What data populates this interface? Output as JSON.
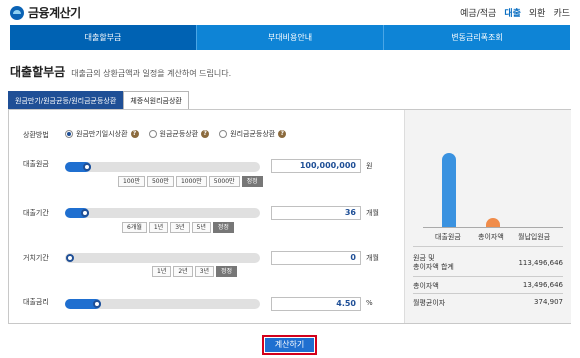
{
  "header": {
    "logo": "금융계산기",
    "nav": [
      "예금/적금",
      "대출",
      "외환",
      "카드"
    ],
    "active_nav": "대출"
  },
  "menu": [
    "대출할부금",
    "부대비용안내",
    "변동금리폭조회"
  ],
  "page": {
    "title": "대출할부금",
    "subtitle": "대출금의 상환금액과 일정을 계산하여 드립니다."
  },
  "tabs": [
    "원금만기/원금균등/원리금균등상환",
    "체증식원리금상환"
  ],
  "form": {
    "repay_label": "상환방법",
    "options": [
      "원금만기일시상환",
      "원금균등상환",
      "원리금균등상환"
    ],
    "principal": {
      "label": "대출원금",
      "value": "100,000,000",
      "unit": "원",
      "buttons": [
        "100만",
        "500만",
        "1000만",
        "5000만",
        "정정"
      ]
    },
    "period": {
      "label": "대출기간",
      "value": "36",
      "unit": "개월",
      "buttons": [
        "6개월",
        "1년",
        "3년",
        "5년",
        "정정"
      ]
    },
    "grace": {
      "label": "거치기간",
      "value": "0",
      "unit": "개월",
      "buttons": [
        "1년",
        "2년",
        "3년",
        "정정"
      ]
    },
    "rate": {
      "label": "대출금리",
      "value": "4.50",
      "unit": "%"
    }
  },
  "chart": {
    "labels": [
      "대출원금",
      "총이자액",
      "월납입원금"
    ]
  },
  "summary": [
    {
      "label": "원금 및\n총이자액 합계",
      "value": "113,496,646"
    },
    {
      "label": "총이자액",
      "value": "13,496,646"
    },
    {
      "label": "월평균이자",
      "value": "374,907"
    }
  ],
  "calc_label": "계산하기",
  "help_icon": "?"
}
